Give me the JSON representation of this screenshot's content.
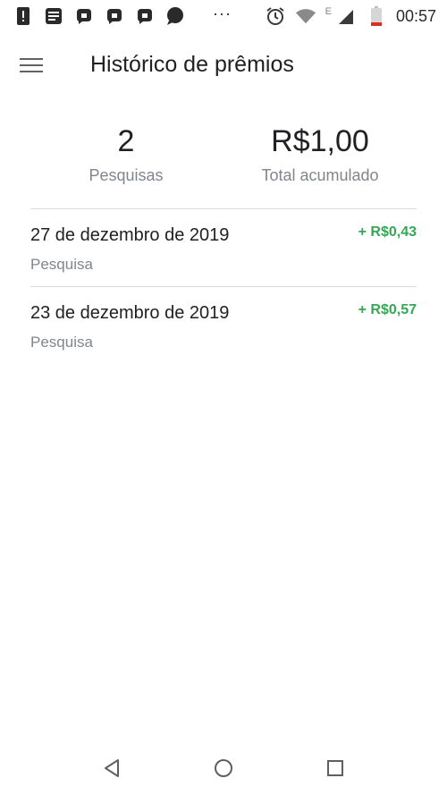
{
  "status_bar": {
    "time": "00:57",
    "network_label": "E",
    "more_indicator": "···",
    "left_icons": [
      "alert-icon",
      "message-icon",
      "app-icon",
      "app-icon",
      "app-icon",
      "chat-icon"
    ],
    "right_icons": [
      "alarm-icon",
      "wifi-icon",
      "signal-icon",
      "battery-low-icon"
    ]
  },
  "toolbar": {
    "title": "Histórico de prêmios",
    "menu_icon": "menu-icon"
  },
  "summary": {
    "count_value": "2",
    "count_label": "Pesquisas",
    "total_value": "R$1,00",
    "total_label": "Total acumulado"
  },
  "rewards": [
    {
      "date": "27 de dezembro de 2019",
      "type": "Pesquisa",
      "amount": "+ R$0,43"
    },
    {
      "date": "23 de dezembro de 2019",
      "type": "Pesquisa",
      "amount": "+ R$0,57"
    }
  ],
  "colors": {
    "positive_amount": "#34a853",
    "battery_low": "#d93025"
  },
  "nav_bar": {
    "icons": [
      "back-icon",
      "home-icon",
      "recents-icon"
    ]
  }
}
